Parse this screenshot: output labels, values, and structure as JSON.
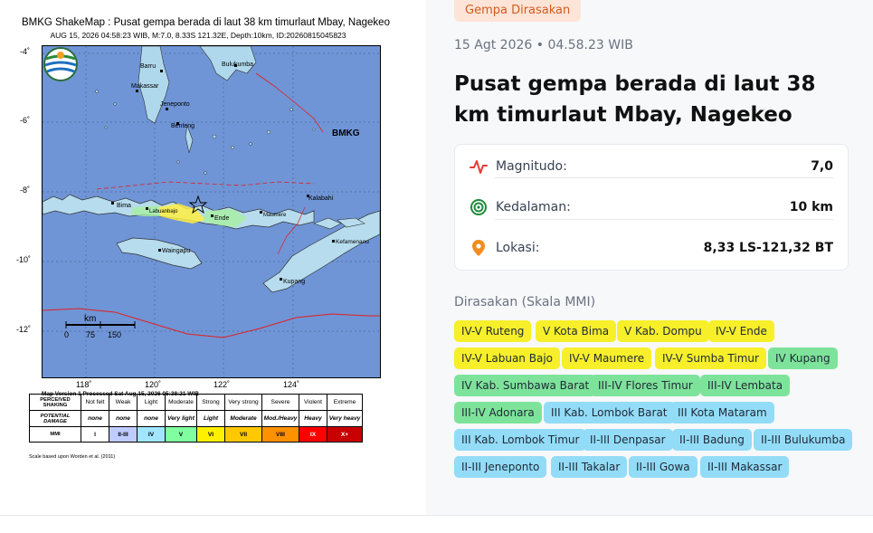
{
  "shakemap": {
    "title": "BMKG ShakeMap : Pusat gempa berada di laut 38 km timurlaut Mbay, Nagekeo",
    "subtitle": "AUG 15, 2026 04:58:23 WIB, M:7.0, 8.33S 121.32E, Depth:10km, ID:20260815045823",
    "lat_labels": [
      "-4˚",
      "-6˚",
      "-8˚",
      "-10˚",
      "-12˚"
    ],
    "lon_labels": [
      "118˚",
      "120˚",
      "122˚",
      "124˚"
    ],
    "places": [
      "Barru",
      "Bulukumba",
      "Makassar",
      "Jeneponto",
      "Benteng",
      "Bima",
      "Labuanbajo",
      "Ende",
      "Maumere",
      "Kalabahi",
      "Waingapu",
      "Kefamenanu",
      "Kupang"
    ],
    "scale_label": "km",
    "scale_ticks": [
      "0",
      "75",
      "150"
    ],
    "logo_text": "BMKG",
    "processed": "Map Version 1 Processed Sat Aug 15, 2026 05:38:21 WIB",
    "legend": {
      "row_headers": [
        "PERCEIVED SHAKING",
        "POTENTIAL DAMAGE",
        "MMI"
      ],
      "shaking": [
        "Not felt",
        "Weak",
        "Light",
        "Moderate",
        "Strong",
        "Very strong",
        "Severe",
        "Violent",
        "Extreme"
      ],
      "damage": [
        "none",
        "none",
        "none",
        "Very light",
        "Light",
        "Moderate",
        "Mod./Heavy",
        "Heavy",
        "Very heavy"
      ],
      "mmi": [
        "I",
        "II-III",
        "IV",
        "V",
        "VI",
        "VII",
        "VIII",
        "IX",
        "X+"
      ],
      "mmi_colors": [
        "#ffffff",
        "#bfccff",
        "#a0e6ff",
        "#80ffa0",
        "#fff000",
        "#ffc800",
        "#ff9000",
        "#ff0000",
        "#c80000"
      ]
    },
    "scale_note": "Scale based upon Worden et al. (2011)"
  },
  "event": {
    "badge": "Gempa Dirasakan",
    "datetime": "15 Agt 2026 • 04.58.23 WIB",
    "headline": "Pusat gempa berada di laut 38 km timurlaut Mbay, Nagekeo",
    "magnitude_label": "Magnitudo:",
    "magnitude_value": "7,0",
    "depth_label": "Kedalaman:",
    "depth_value": "10 km",
    "location_label": "Lokasi:",
    "location_value": "8,33 LS-121,32 BT"
  },
  "felt": {
    "heading": "Dirasakan (Skala MMI)",
    "items": [
      {
        "label": "IV-V Ruteng",
        "level": "yellow"
      },
      {
        "label": "V Kota Bima",
        "level": "yellow"
      },
      {
        "label": "V Kab. Dompu",
        "level": "yellow"
      },
      {
        "label": "IV-V Ende",
        "level": "yellow"
      },
      {
        "label": "IV-V Labuan Bajo",
        "level": "yellow"
      },
      {
        "label": "IV-V Maumere",
        "level": "yellow"
      },
      {
        "label": "IV-V Sumba Timur",
        "level": "yellow"
      },
      {
        "label": "IV Kupang",
        "level": "green"
      },
      {
        "label": "IV Kab. Sumbawa Barat",
        "level": "green"
      },
      {
        "label": "III-IV Flores Timur",
        "level": "green"
      },
      {
        "label": "III-IV Lembata",
        "level": "green"
      },
      {
        "label": "III-IV Adonara",
        "level": "green"
      },
      {
        "label": "III Kab. Lombok Barat",
        "level": "blue"
      },
      {
        "label": "III Kota Mataram",
        "level": "blue"
      },
      {
        "label": "III Kab. Lombok Timur",
        "level": "blue"
      },
      {
        "label": "II-III Denpasar",
        "level": "blue"
      },
      {
        "label": "II-III Badung",
        "level": "blue"
      },
      {
        "label": "II-III Bulukumba",
        "level": "blue"
      },
      {
        "label": "II-III Jeneponto",
        "level": "blue"
      },
      {
        "label": "II-III Takalar",
        "level": "blue"
      },
      {
        "label": "II-III Gowa",
        "level": "blue"
      },
      {
        "label": "II-III Makassar",
        "level": "blue"
      }
    ]
  }
}
